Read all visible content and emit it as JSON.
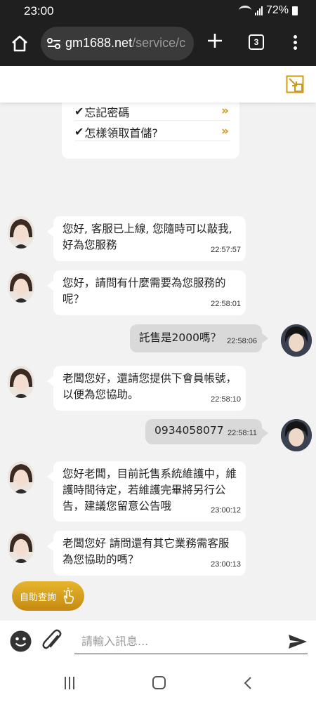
{
  "status_bar": {
    "time": "23:00",
    "battery": "72%"
  },
  "browser": {
    "url_host": "gm1688.net",
    "url_path": "/service/c",
    "tab_count": "3"
  },
  "faq": {
    "items": [
      {
        "check": "✔",
        "label": "忘記密碼",
        "arrow": "»"
      },
      {
        "check": "✔",
        "label": "怎樣領取首儲?",
        "arrow": "»"
      }
    ]
  },
  "messages": [
    {
      "from": "agent",
      "text": "您好, 客服已上線, 您隨時可以敲我,\n好為您服務",
      "time": "22:57:57"
    },
    {
      "from": "agent",
      "text": "您好，請問有什麼需要為您服務的\n呢？",
      "time": "22:58:01"
    },
    {
      "from": "user",
      "text": "託售是2000嗎？",
      "time": "22:58:06"
    },
    {
      "from": "agent",
      "text": "老闆您好，還請您提供下會員帳號，\n以便為您協助。",
      "time": "22:58:10"
    },
    {
      "from": "user",
      "text": "0934058077",
      "time": "22:58:11"
    },
    {
      "from": "agent",
      "text": "您好老闆，目前託售系統維護中，維\n護時間待定，若維護完畢將另行公\n告，建議您留意公告哦",
      "time": "23:00:12"
    },
    {
      "from": "agent",
      "text": "老闆您好 請問還有其它業務需客服\n為您協助的嗎？",
      "time": "23:00:13"
    }
  ],
  "self_service": {
    "label": "自助查詢"
  },
  "composer": {
    "placeholder": "請輸入訊息..."
  },
  "colors": {
    "accent_gold": "#d09a10",
    "bubble_out": "#d9d9d9",
    "browser_bg": "#1f1f1f"
  }
}
